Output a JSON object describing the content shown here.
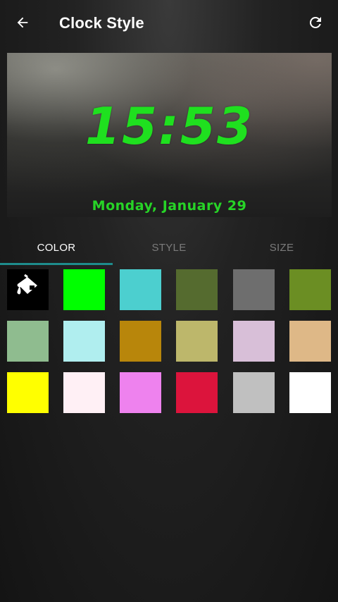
{
  "toolbar": {
    "title": "Clock Style",
    "back_icon": "arrow-left-icon",
    "refresh_icon": "refresh-icon"
  },
  "preview": {
    "time": "15:53",
    "date": "Monday, January 29",
    "clock_color": "#1fe01f"
  },
  "tabs": [
    {
      "label": "COLOR",
      "active": true
    },
    {
      "label": "STYLE",
      "active": false
    },
    {
      "label": "SIZE",
      "active": false
    }
  ],
  "accent_color": "#1e8c8c",
  "color_tool_icon": "paint-bucket-icon",
  "swatches": [
    "#00ff00",
    "#4ccfcf",
    "#556b2f",
    "#6e6e6e",
    "#6b8e23",
    "#8fbc8f",
    "#b0eeef",
    "#b8860b",
    "#bdb76b",
    "#d8bfd8",
    "#deb887",
    "#ffff00",
    "#fff0f5",
    "#ee82ee",
    "#dc143c",
    "#c0c0c0",
    "#ffffff"
  ]
}
